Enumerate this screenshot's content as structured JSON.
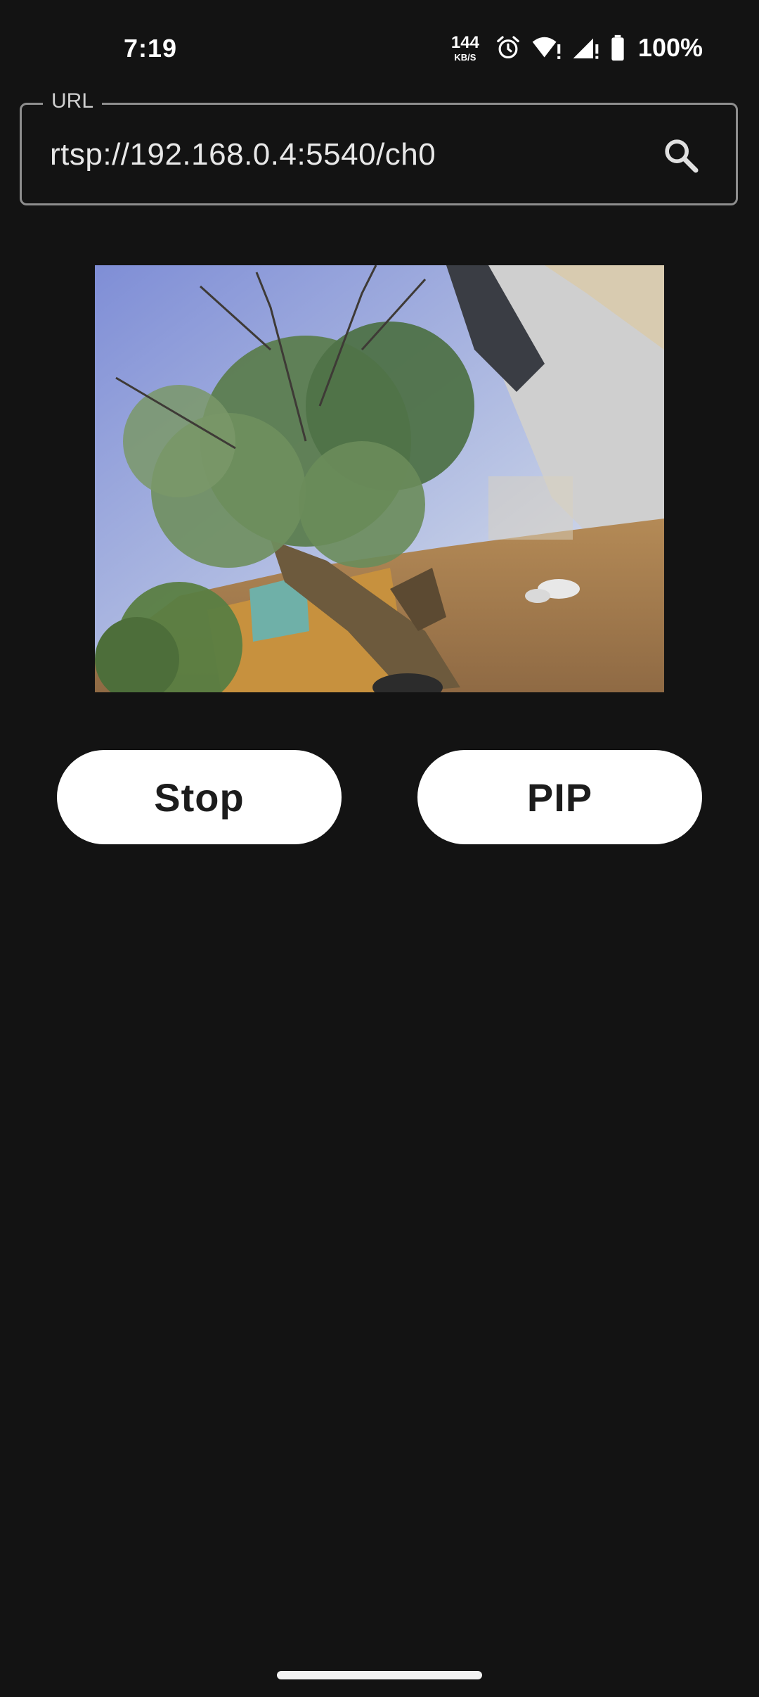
{
  "status_bar": {
    "time": "7:19",
    "net_speed_value": "144",
    "net_speed_unit": "KB/S",
    "battery_percent": "100%",
    "icons": [
      "alarm-icon",
      "wifi-icon",
      "cellular-icon",
      "battery-icon"
    ]
  },
  "url_field": {
    "label": "URL",
    "value": "rtsp://192.168.0.4:5540/ch0",
    "action_icon": "search-icon"
  },
  "video": {
    "description_icon": "video-stream"
  },
  "buttons": {
    "stop_label": "Stop",
    "pip_label": "PIP"
  },
  "colors": {
    "background": "#131313",
    "button_bg": "#ffffff",
    "button_text": "#1c1c1c",
    "field_border": "#8e8e8e"
  }
}
